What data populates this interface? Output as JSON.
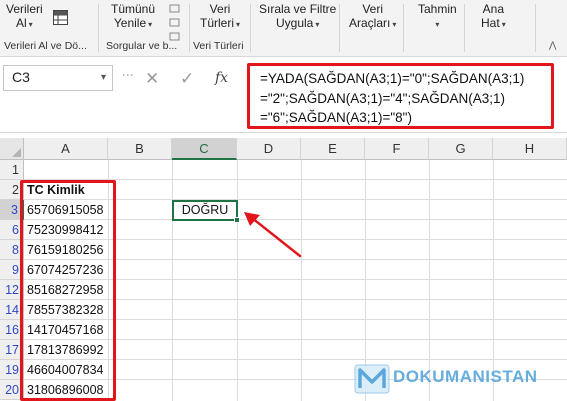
{
  "ribbon": {
    "groups": [
      {
        "title": "Verileri Al ve Dö...",
        "buttons": [
          {
            "label": "Verileri",
            "sub": "Al"
          }
        ]
      },
      {
        "title": "Sorgular ve b...",
        "buttons": [
          {
            "label": "Tümünü",
            "sub": "Yenile"
          }
        ]
      },
      {
        "title": "Veri Türleri",
        "buttons": [
          {
            "label": "Veri",
            "sub": "Türleri"
          }
        ]
      },
      {
        "title": "",
        "buttons": [
          {
            "label": "Sırala ve Filtre",
            "sub": "Uygula"
          }
        ]
      },
      {
        "title": "",
        "buttons": [
          {
            "label": "Veri",
            "sub": "Araçları"
          }
        ]
      },
      {
        "title": "",
        "buttons": [
          {
            "label": "Tahmin",
            "sub": ""
          }
        ]
      },
      {
        "title": "",
        "buttons": [
          {
            "label": "Ana",
            "sub": "Hat"
          }
        ]
      }
    ]
  },
  "formula_bar": {
    "name_box": "C3",
    "formula": "=YADA(SAĞDAN(A3;1)=\"0\";SAĞDAN(A3;1)=\"2\";SAĞDAN(A3;1)=\"4\";SAĞDAN(A3;1)=\"6\";SAĞDAN(A3;1)=\"8\")",
    "formula_lines": [
      "=YADA(SAĞDAN(A3;1)=\"0\";SAĞDAN(A3;1)",
      "=\"2\";SAĞDAN(A3;1)=\"4\";SAĞDAN(A3;1)",
      "=\"6\";SAĞDAN(A3;1)=\"8\")"
    ]
  },
  "grid": {
    "columns": [
      "A",
      "B",
      "C",
      "D",
      "E",
      "F",
      "G",
      "H"
    ],
    "selected_column": "C",
    "rows": [
      {
        "num": "1",
        "a": "",
        "filtered": false
      },
      {
        "num": "2",
        "a": "TC Kimlik",
        "filtered": false,
        "bold": true
      },
      {
        "num": "3",
        "a": "65706915058",
        "filtered": true,
        "selected": true
      },
      {
        "num": "6",
        "a": "75230998412",
        "filtered": true
      },
      {
        "num": "8",
        "a": "76159180256",
        "filtered": true
      },
      {
        "num": "9",
        "a": "67074257236",
        "filtered": true
      },
      {
        "num": "12",
        "a": "85168272958",
        "filtered": true
      },
      {
        "num": "14",
        "a": "78557382328",
        "filtered": true
      },
      {
        "num": "16",
        "a": "14170457168",
        "filtered": true
      },
      {
        "num": "17",
        "a": "17813786992",
        "filtered": true
      },
      {
        "num": "19",
        "a": "46604007834",
        "filtered": true
      },
      {
        "num": "20",
        "a": "31806896008",
        "filtered": true
      }
    ],
    "c3_value": "DOĞRU"
  },
  "watermark": {
    "text": "DOKUMANISTAN"
  },
  "colors": {
    "highlight_red": "#e1161c",
    "excel_green": "#217346",
    "filtered_row_blue": "#2f48c9"
  }
}
